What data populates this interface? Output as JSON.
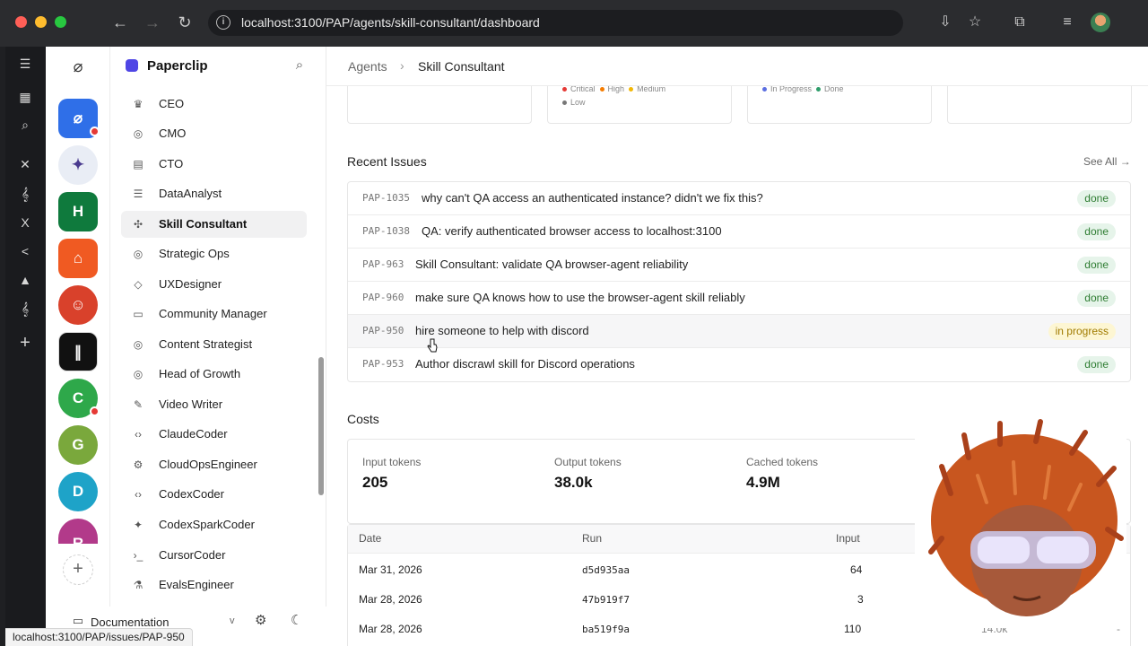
{
  "browser": {
    "url": "localhost:3100/PAP/agents/skill-consultant/dashboard",
    "hover_link": "localhost:3100/PAP/issues/PAP-950"
  },
  "company_initials": [
    "C",
    "G",
    "D",
    "R"
  ],
  "sidebar": {
    "brand": "Paperclip",
    "items": [
      {
        "label": "CEO",
        "icon": "crown-icon",
        "glyph": "♛"
      },
      {
        "label": "CMO",
        "icon": "globe-icon",
        "glyph": "◎"
      },
      {
        "label": "CTO",
        "icon": "code-file-icon",
        "glyph": "▤"
      },
      {
        "label": "DataAnalyst",
        "icon": "database-icon",
        "glyph": "☰"
      },
      {
        "label": "Skill Consultant",
        "icon": "puzzle-icon",
        "glyph": "✣"
      },
      {
        "label": "Strategic Ops",
        "icon": "target-icon",
        "glyph": "◎"
      },
      {
        "label": "UXDesigner",
        "icon": "gem-icon",
        "glyph": "◇"
      },
      {
        "label": "Community Manager",
        "icon": "message-icon",
        "glyph": "▭"
      },
      {
        "label": "Content Strategist",
        "icon": "target-icon",
        "glyph": "◎"
      },
      {
        "label": "Head of Growth",
        "icon": "target-icon",
        "glyph": "◎"
      },
      {
        "label": "Video Writer",
        "icon": "wand-icon",
        "glyph": "✎"
      },
      {
        "label": "ClaudeCoder",
        "icon": "code-icon",
        "glyph": "‹›"
      },
      {
        "label": "CloudOpsEngineer",
        "icon": "gear-icon",
        "glyph": "⚙"
      },
      {
        "label": "CodexCoder",
        "icon": "code-icon",
        "glyph": "‹›"
      },
      {
        "label": "CodexSparkCoder",
        "icon": "sparkles-icon",
        "glyph": "✦"
      },
      {
        "label": "CursorCoder",
        "icon": "terminal-icon",
        "glyph": "›_"
      },
      {
        "label": "EvalsEngineer",
        "icon": "flask-icon",
        "glyph": "⚗"
      }
    ],
    "footer_doc": "Documentation"
  },
  "breadcrumb": {
    "parent": "Agents",
    "current": "Skill Consultant"
  },
  "legend": {
    "priority": [
      "Critical",
      "High",
      "Medium",
      "Low"
    ],
    "status": [
      "In Progress",
      "Done"
    ]
  },
  "colors": {
    "critical": "#e53935",
    "high": "#f57c00",
    "medium": "#f2b705",
    "low": "#777777",
    "in_progress": "#5b6ee1",
    "done": "#2e9d6a"
  },
  "recent_issues": {
    "title": "Recent Issues",
    "see_all": "See All →",
    "rows": [
      {
        "id": "PAP-1035",
        "title": "why can't QA access an authenticated instance? didn't we fix this?",
        "status": "done"
      },
      {
        "id": "PAP-1038",
        "title": "QA: verify authenticated browser access to localhost:3100",
        "status": "done"
      },
      {
        "id": "PAP-963",
        "title": "Skill Consultant: validate QA browser-agent reliability",
        "status": "done"
      },
      {
        "id": "PAP-960",
        "title": "make sure QA knows how to use the browser-agent skill reliably",
        "status": "done"
      },
      {
        "id": "PAP-950",
        "title": "hire someone to help with discord",
        "status": "in progress"
      },
      {
        "id": "PAP-953",
        "title": "Author discrawl skill for Discord operations",
        "status": "done"
      }
    ]
  },
  "costs": {
    "title": "Costs",
    "input_label": "Input tokens",
    "input_value": "205",
    "output_label": "Output tokens",
    "output_value": "38.0k",
    "cached_label": "Cached tokens",
    "cached_value": "4.9M"
  },
  "runs": {
    "headers": {
      "date": "Date",
      "run": "Run",
      "input": "Input"
    },
    "rows": [
      {
        "date": "Mar 31, 2026",
        "run": "d5d935aa",
        "input": "64"
      },
      {
        "date": "Mar 28, 2026",
        "run": "47b919f7",
        "input": "3"
      },
      {
        "date": "Mar 28, 2026",
        "run": "ba519f9a",
        "input": "110",
        "extra": "14.0k",
        "dash": "-"
      }
    ]
  }
}
